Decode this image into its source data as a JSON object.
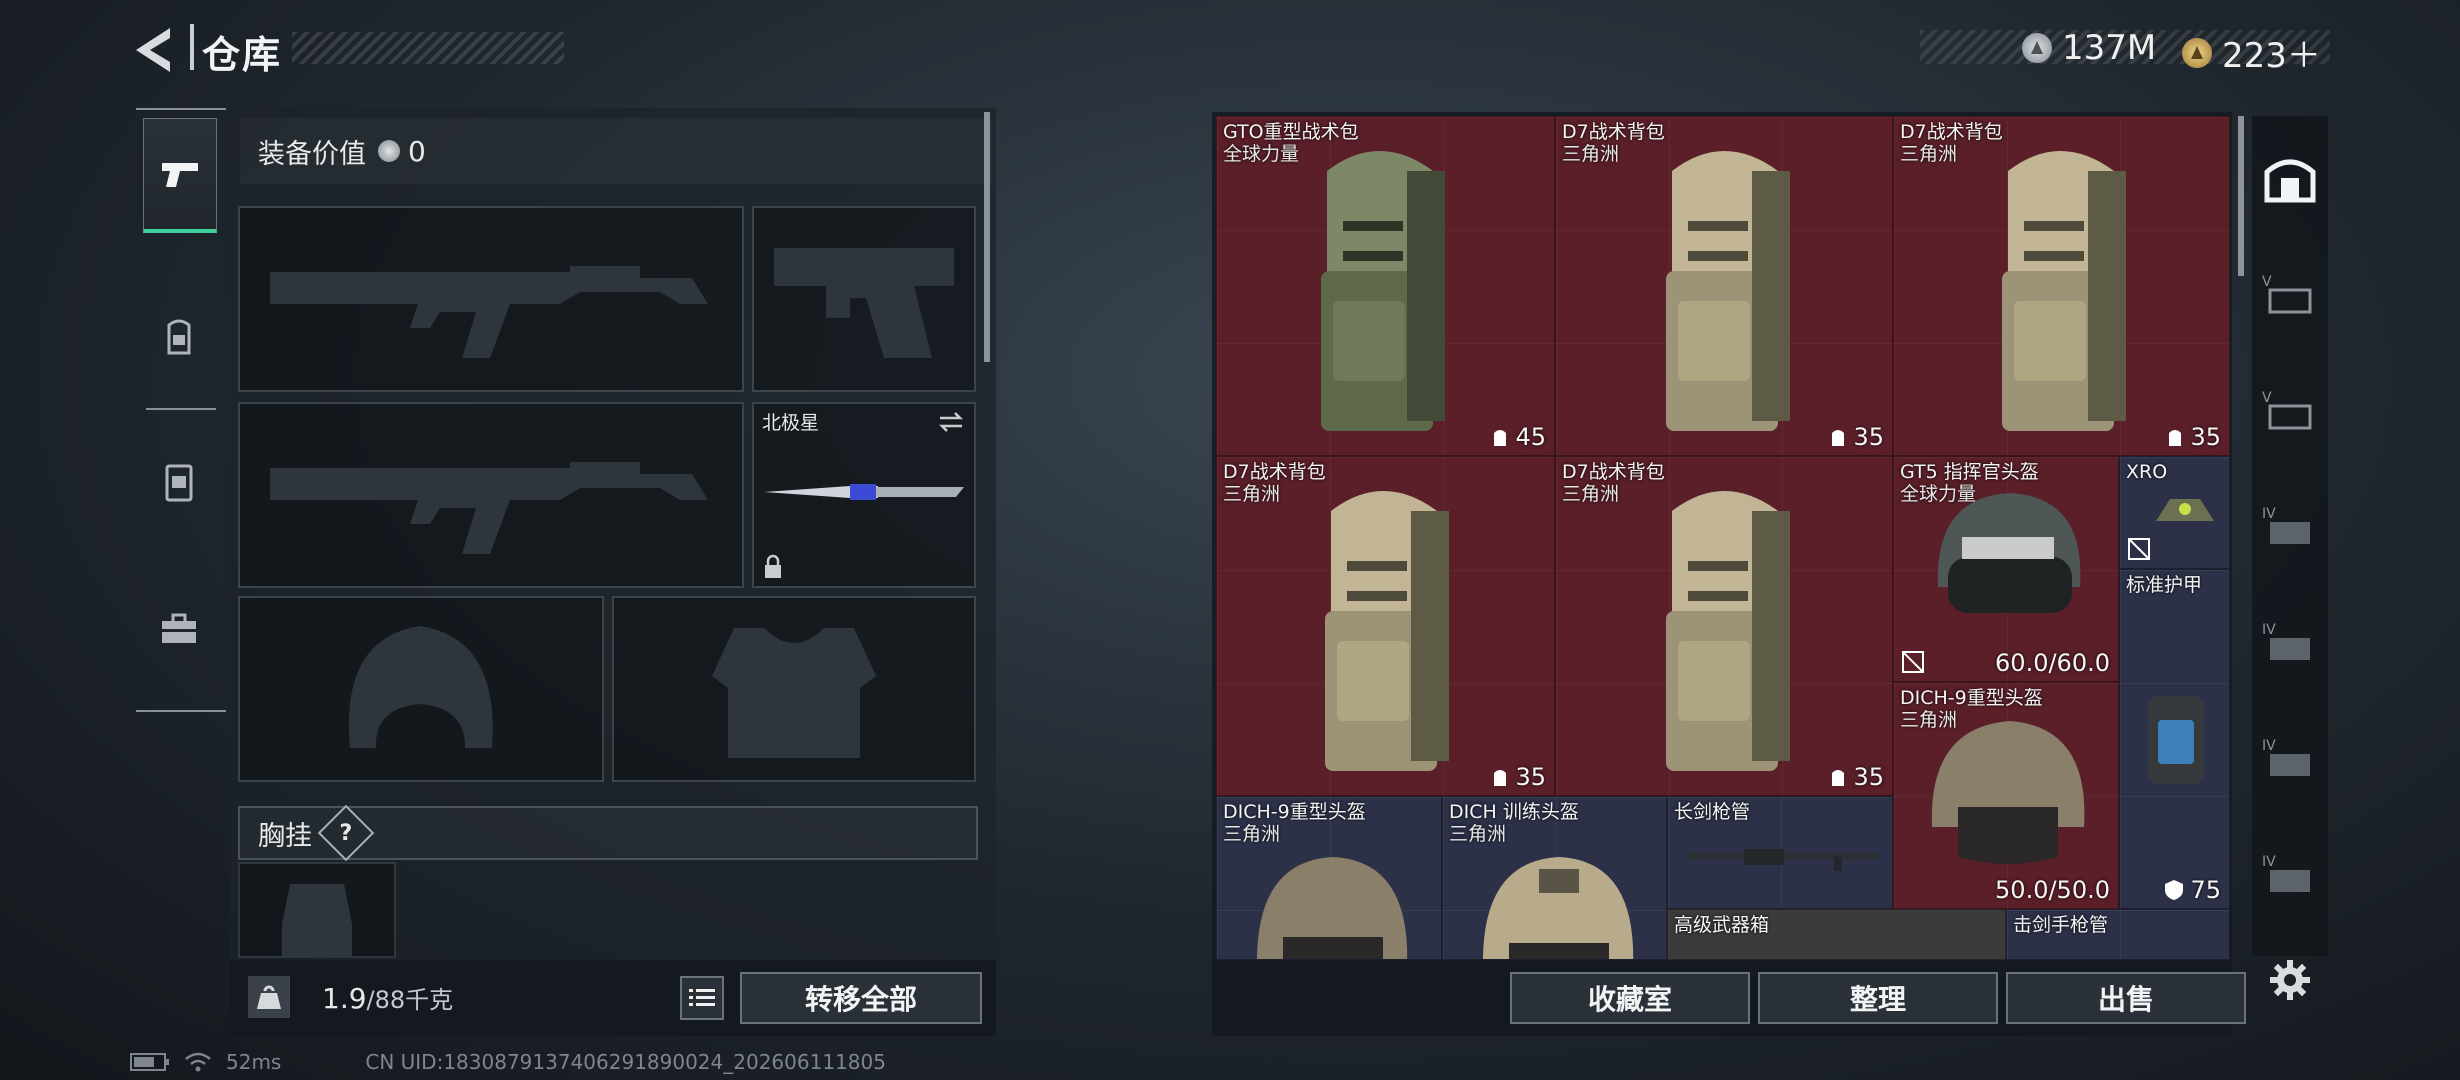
{
  "header": {
    "title": "仓库",
    "back_icon": "back-arrow-icon"
  },
  "currency": [
    {
      "icon": "silver-coin-icon",
      "value": "137M",
      "color": "#b9bec4"
    },
    {
      "icon": "gold-coin-icon",
      "value": "223＋",
      "color": "#c9a45a"
    }
  ],
  "left_tabs": [
    {
      "icon": "pistol-icon",
      "active": true
    },
    {
      "icon": "backpack-icon",
      "active": false
    },
    {
      "icon": "vest-icon",
      "active": false
    },
    {
      "icon": "case-icon",
      "active": false
    }
  ],
  "loadout": {
    "value_label": "装备价值",
    "value": "0",
    "melee_name": "北极星",
    "chest_label": "胸挂",
    "help": "?",
    "weight_value": "1.9",
    "weight_max": "/88千克",
    "transfer_all": "转移全部"
  },
  "items": [
    {
      "name": "GTO重型战术包",
      "sub": "全球力量",
      "capacity": "45"
    },
    {
      "name": "D7战术背包",
      "sub": "三角洲",
      "capacity": "35"
    },
    {
      "name": "D7战术背包",
      "sub": "三角洲",
      "capacity": "35"
    },
    {
      "name": "D7战术背包",
      "sub": "三角洲",
      "capacity": "35"
    },
    {
      "name": "D7战术背包",
      "sub": "三角洲",
      "capacity": "35"
    },
    {
      "name": "GT5 指挥官头盔",
      "sub": "全球力量",
      "durability": "60.0/60.0"
    },
    {
      "name": "XRO"
    },
    {
      "name": "标准护甲",
      "armor": "75"
    },
    {
      "name": "DICH-9重型头盔",
      "sub": "三角洲",
      "durability": "50.0/50.0"
    },
    {
      "name": "DICH-9重型头盔",
      "sub": "三角洲"
    },
    {
      "name": "DICH 训练头盔",
      "sub": "三角洲"
    },
    {
      "name": "长剑枪管"
    },
    {
      "name": "高级武器箱"
    },
    {
      "name": "击剑手枪管"
    }
  ],
  "buttons": {
    "collection": "收藏室",
    "sort": "整理",
    "sell": "出售"
  },
  "right_rail": [
    {
      "icon": "stash-icon",
      "active": true
    },
    {
      "icon": "case-v-icon"
    },
    {
      "icon": "case-v-icon"
    },
    {
      "icon": "case-iv-icon"
    },
    {
      "icon": "case-iv-icon"
    },
    {
      "icon": "case-iv-icon"
    },
    {
      "icon": "case-iv-icon"
    },
    {
      "icon": "settings-gear-icon"
    }
  ],
  "footer": {
    "ping": "52ms",
    "uid": "CN UID:1830879137406291890024_202606111805"
  }
}
